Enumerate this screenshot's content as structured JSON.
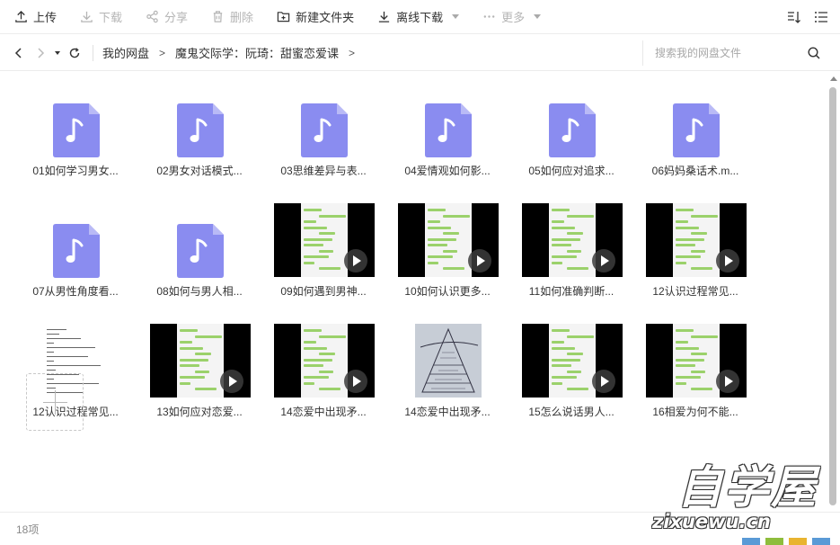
{
  "toolbar": {
    "upload": "上传",
    "download": "下载",
    "share": "分享",
    "delete": "删除",
    "new_folder": "新建文件夹",
    "offline_download": "离线下载",
    "more": "更多"
  },
  "breadcrumb": {
    "root": "我的网盘",
    "folder": "魔鬼交际学：阮琦：甜蜜恋爱课",
    "sep": ">"
  },
  "search": {
    "placeholder": "搜索我的网盘文件"
  },
  "files": [
    {
      "name": "01如何学习男女...",
      "type": "audio"
    },
    {
      "name": "02男女对话模式...",
      "type": "audio"
    },
    {
      "name": "03思维差异与表...",
      "type": "audio"
    },
    {
      "name": "04爱情观如何影...",
      "type": "audio"
    },
    {
      "name": "05如何应对追求...",
      "type": "audio"
    },
    {
      "name": "06妈妈桑话术.m...",
      "type": "audio"
    },
    {
      "name": "07从男性角度看...",
      "type": "audio"
    },
    {
      "name": "08如何与男人相...",
      "type": "audio"
    },
    {
      "name": "09如何遇到男神...",
      "type": "video"
    },
    {
      "name": "10如何认识更多...",
      "type": "video"
    },
    {
      "name": "11如何准确判断...",
      "type": "video"
    },
    {
      "name": "12认识过程常见...",
      "type": "video"
    },
    {
      "name": "12认识过程常见...",
      "type": "doc"
    },
    {
      "name": "13如何应对恋爱...",
      "type": "video"
    },
    {
      "name": "14恋爱中出现矛...",
      "type": "video"
    },
    {
      "name": "14恋爱中出现矛...",
      "type": "sketch"
    },
    {
      "name": "15怎么说话男人...",
      "type": "video"
    },
    {
      "name": "16相爱为何不能...",
      "type": "video"
    }
  ],
  "status": {
    "count": "18项"
  },
  "watermark": {
    "title": "自学屋",
    "url": "zixuewu.cn"
  },
  "colors": {
    "audio_icon": "#8a8cf0",
    "video_bar": "#9bd16b",
    "toolbar_text": "#333333"
  }
}
